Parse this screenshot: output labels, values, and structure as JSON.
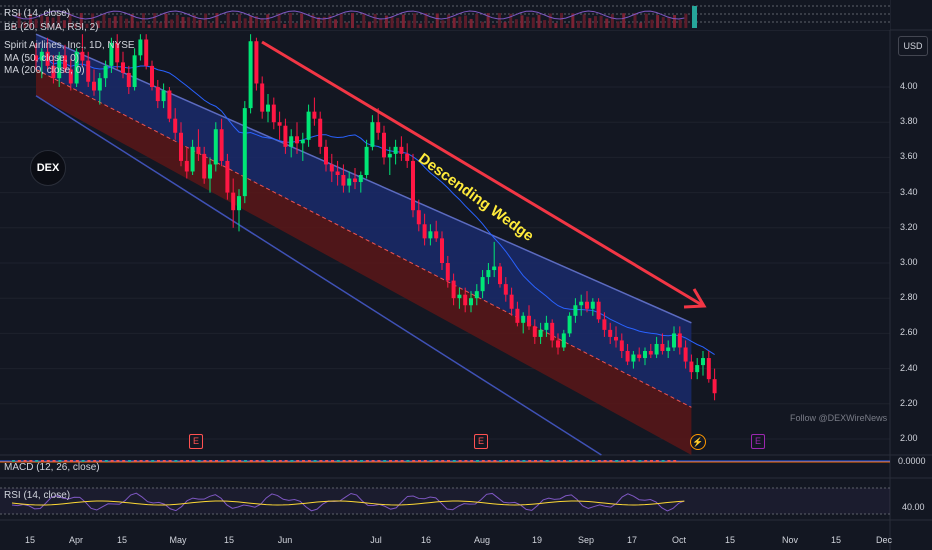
{
  "header": {
    "rsi_top": "RSI (14, close)",
    "bb_top": "BB (20, SMA, RSI, 2)",
    "symbol": "Spirit Airlines, Inc., 1D, NYSE",
    "ma50": "MA (50, close, 0)",
    "ma200": "MA (200, close, 0)"
  },
  "currency_button": "USD",
  "logo_text": "DEX",
  "annotation": "Descending Wedge",
  "watermark": "Follow @DEXWireNews",
  "macd_label": "MACD (12, 26, close)",
  "macd_value": "0.0000",
  "rsi_label": "RSI (14, close)",
  "rsi_value": "40.00",
  "earnings_badge": "E",
  "colors": {
    "up": "#00e676",
    "down": "#ff1744",
    "upper_fill": "#1a2a6b",
    "lower_fill": "#5a1618",
    "annotation": "#ffeb3b",
    "trend_arrow": "#f23645",
    "ma": "#2962ff"
  },
  "chart_data": {
    "type": "candlestick",
    "title": "Spirit Airlines, Inc., 1D, NYSE",
    "y_axis": {
      "ticks": [
        "4.00",
        "3.80",
        "3.60",
        "3.40",
        "3.20",
        "3.00",
        "2.80",
        "2.60",
        "2.40",
        "2.20",
        "2.00"
      ],
      "ylim": [
        1.9,
        4.35
      ]
    },
    "x_axis": {
      "ticks": [
        "15",
        "Apr",
        "15",
        "May",
        "15",
        "Jun",
        "Jul",
        "16",
        "Aug",
        "19",
        "Sep",
        "17",
        "Oct",
        "15",
        "Nov",
        "15",
        "Dec"
      ]
    },
    "candles": [
      {
        "o": 4.18,
        "h": 4.25,
        "l": 4.1,
        "c": 4.15
      },
      {
        "o": 4.15,
        "h": 4.22,
        "l": 4.05,
        "c": 4.2
      },
      {
        "o": 4.2,
        "h": 4.28,
        "l": 4.1,
        "c": 4.12
      },
      {
        "o": 4.12,
        "h": 4.18,
        "l": 4.02,
        "c": 4.05
      },
      {
        "o": 4.05,
        "h": 4.2,
        "l": 4.0,
        "c": 4.18
      },
      {
        "o": 4.18,
        "h": 4.24,
        "l": 4.08,
        "c": 4.1
      },
      {
        "o": 4.1,
        "h": 4.16,
        "l": 3.98,
        "c": 4.02
      },
      {
        "o": 4.02,
        "h": 4.22,
        "l": 4.0,
        "c": 4.2
      },
      {
        "o": 4.2,
        "h": 4.3,
        "l": 4.12,
        "c": 4.15
      },
      {
        "o": 4.15,
        "h": 4.2,
        "l": 4.0,
        "c": 4.03
      },
      {
        "o": 4.03,
        "h": 4.1,
        "l": 3.95,
        "c": 3.98
      },
      {
        "o": 3.98,
        "h": 4.08,
        "l": 3.9,
        "c": 4.05
      },
      {
        "o": 4.05,
        "h": 4.15,
        "l": 4.0,
        "c": 4.12
      },
      {
        "o": 4.12,
        "h": 4.28,
        "l": 4.08,
        "c": 4.25
      },
      {
        "o": 4.25,
        "h": 4.3,
        "l": 4.1,
        "c": 4.14
      },
      {
        "o": 4.14,
        "h": 4.2,
        "l": 4.05,
        "c": 4.08
      },
      {
        "o": 4.08,
        "h": 4.12,
        "l": 3.96,
        "c": 4.0
      },
      {
        "o": 4.0,
        "h": 4.22,
        "l": 3.98,
        "c": 4.18
      },
      {
        "o": 4.18,
        "h": 4.3,
        "l": 4.15,
        "c": 4.27
      },
      {
        "o": 4.27,
        "h": 4.3,
        "l": 4.1,
        "c": 4.12
      },
      {
        "o": 4.12,
        "h": 4.15,
        "l": 3.98,
        "c": 4.0
      },
      {
        "o": 4.0,
        "h": 4.04,
        "l": 3.88,
        "c": 3.92
      },
      {
        "o": 3.92,
        "h": 4.02,
        "l": 3.88,
        "c": 3.98
      },
      {
        "o": 3.98,
        "h": 4.0,
        "l": 3.8,
        "c": 3.82
      },
      {
        "o": 3.82,
        "h": 3.88,
        "l": 3.7,
        "c": 3.74
      },
      {
        "o": 3.74,
        "h": 3.8,
        "l": 3.55,
        "c": 3.58
      },
      {
        "o": 3.58,
        "h": 3.66,
        "l": 3.48,
        "c": 3.52
      },
      {
        "o": 3.52,
        "h": 3.7,
        "l": 3.5,
        "c": 3.66
      },
      {
        "o": 3.66,
        "h": 3.76,
        "l": 3.58,
        "c": 3.62
      },
      {
        "o": 3.62,
        "h": 3.66,
        "l": 3.45,
        "c": 3.48
      },
      {
        "o": 3.48,
        "h": 3.6,
        "l": 3.4,
        "c": 3.56
      },
      {
        "o": 3.56,
        "h": 3.8,
        "l": 3.52,
        "c": 3.76
      },
      {
        "o": 3.76,
        "h": 3.82,
        "l": 3.55,
        "c": 3.58
      },
      {
        "o": 3.58,
        "h": 3.62,
        "l": 3.36,
        "c": 3.4
      },
      {
        "o": 3.4,
        "h": 3.48,
        "l": 3.2,
        "c": 3.3
      },
      {
        "o": 3.3,
        "h": 3.42,
        "l": 3.18,
        "c": 3.38
      },
      {
        "o": 3.38,
        "h": 3.92,
        "l": 3.34,
        "c": 3.88
      },
      {
        "o": 3.88,
        "h": 4.3,
        "l": 3.85,
        "c": 4.26
      },
      {
        "o": 4.26,
        "h": 4.28,
        "l": 3.98,
        "c": 4.02
      },
      {
        "o": 4.02,
        "h": 4.06,
        "l": 3.82,
        "c": 3.86
      },
      {
        "o": 3.86,
        "h": 3.96,
        "l": 3.8,
        "c": 3.9
      },
      {
        "o": 3.9,
        "h": 3.94,
        "l": 3.76,
        "c": 3.8
      },
      {
        "o": 3.8,
        "h": 3.86,
        "l": 3.7,
        "c": 3.78
      },
      {
        "o": 3.78,
        "h": 3.82,
        "l": 3.62,
        "c": 3.66
      },
      {
        "o": 3.66,
        "h": 3.76,
        "l": 3.6,
        "c": 3.72
      },
      {
        "o": 3.72,
        "h": 3.8,
        "l": 3.62,
        "c": 3.68
      },
      {
        "o": 3.68,
        "h": 3.74,
        "l": 3.58,
        "c": 3.7
      },
      {
        "o": 3.7,
        "h": 3.9,
        "l": 3.66,
        "c": 3.86
      },
      {
        "o": 3.86,
        "h": 3.94,
        "l": 3.78,
        "c": 3.82
      },
      {
        "o": 3.82,
        "h": 3.86,
        "l": 3.62,
        "c": 3.66
      },
      {
        "o": 3.66,
        "h": 3.7,
        "l": 3.52,
        "c": 3.56
      },
      {
        "o": 3.56,
        "h": 3.62,
        "l": 3.46,
        "c": 3.52
      },
      {
        "o": 3.52,
        "h": 3.58,
        "l": 3.44,
        "c": 3.5
      },
      {
        "o": 3.5,
        "h": 3.56,
        "l": 3.4,
        "c": 3.44
      },
      {
        "o": 3.44,
        "h": 3.52,
        "l": 3.4,
        "c": 3.48
      },
      {
        "o": 3.48,
        "h": 3.54,
        "l": 3.42,
        "c": 3.46
      },
      {
        "o": 3.46,
        "h": 3.52,
        "l": 3.4,
        "c": 3.5
      },
      {
        "o": 3.5,
        "h": 3.7,
        "l": 3.48,
        "c": 3.66
      },
      {
        "o": 3.66,
        "h": 3.84,
        "l": 3.64,
        "c": 3.8
      },
      {
        "o": 3.8,
        "h": 3.88,
        "l": 3.7,
        "c": 3.74
      },
      {
        "o": 3.74,
        "h": 3.78,
        "l": 3.56,
        "c": 3.6
      },
      {
        "o": 3.6,
        "h": 3.66,
        "l": 3.5,
        "c": 3.62
      },
      {
        "o": 3.62,
        "h": 3.7,
        "l": 3.56,
        "c": 3.66
      },
      {
        "o": 3.66,
        "h": 3.72,
        "l": 3.58,
        "c": 3.62
      },
      {
        "o": 3.62,
        "h": 3.68,
        "l": 3.54,
        "c": 3.58
      },
      {
        "o": 3.58,
        "h": 3.62,
        "l": 3.26,
        "c": 3.3
      },
      {
        "o": 3.3,
        "h": 3.36,
        "l": 3.18,
        "c": 3.22
      },
      {
        "o": 3.22,
        "h": 3.28,
        "l": 3.1,
        "c": 3.14
      },
      {
        "o": 3.14,
        "h": 3.22,
        "l": 3.1,
        "c": 3.18
      },
      {
        "o": 3.18,
        "h": 3.24,
        "l": 3.12,
        "c": 3.14
      },
      {
        "o": 3.14,
        "h": 3.18,
        "l": 2.96,
        "c": 3.0
      },
      {
        "o": 3.0,
        "h": 3.04,
        "l": 2.86,
        "c": 2.9
      },
      {
        "o": 2.9,
        "h": 2.94,
        "l": 2.76,
        "c": 2.8
      },
      {
        "o": 2.8,
        "h": 2.86,
        "l": 2.74,
        "c": 2.82
      },
      {
        "o": 2.82,
        "h": 2.86,
        "l": 2.72,
        "c": 2.76
      },
      {
        "o": 2.76,
        "h": 2.84,
        "l": 2.72,
        "c": 2.8
      },
      {
        "o": 2.8,
        "h": 2.88,
        "l": 2.76,
        "c": 2.84
      },
      {
        "o": 2.84,
        "h": 2.96,
        "l": 2.8,
        "c": 2.92
      },
      {
        "o": 2.92,
        "h": 3.0,
        "l": 2.88,
        "c": 2.96
      },
      {
        "o": 2.96,
        "h": 3.12,
        "l": 2.92,
        "c": 2.98
      },
      {
        "o": 2.98,
        "h": 3.0,
        "l": 2.86,
        "c": 2.88
      },
      {
        "o": 2.88,
        "h": 2.92,
        "l": 2.78,
        "c": 2.82
      },
      {
        "o": 2.82,
        "h": 2.86,
        "l": 2.7,
        "c": 2.74
      },
      {
        "o": 2.74,
        "h": 2.78,
        "l": 2.64,
        "c": 2.66
      },
      {
        "o": 2.66,
        "h": 2.72,
        "l": 2.6,
        "c": 2.7
      },
      {
        "o": 2.7,
        "h": 2.76,
        "l": 2.62,
        "c": 2.64
      },
      {
        "o": 2.64,
        "h": 2.68,
        "l": 2.54,
        "c": 2.58
      },
      {
        "o": 2.58,
        "h": 2.66,
        "l": 2.54,
        "c": 2.62
      },
      {
        "o": 2.62,
        "h": 2.7,
        "l": 2.58,
        "c": 2.66
      },
      {
        "o": 2.66,
        "h": 2.68,
        "l": 2.52,
        "c": 2.56
      },
      {
        "o": 2.56,
        "h": 2.6,
        "l": 2.48,
        "c": 2.52
      },
      {
        "o": 2.52,
        "h": 2.62,
        "l": 2.5,
        "c": 2.6
      },
      {
        "o": 2.6,
        "h": 2.72,
        "l": 2.58,
        "c": 2.7
      },
      {
        "o": 2.7,
        "h": 2.8,
        "l": 2.66,
        "c": 2.76
      },
      {
        "o": 2.76,
        "h": 2.82,
        "l": 2.7,
        "c": 2.78
      },
      {
        "o": 2.78,
        "h": 2.84,
        "l": 2.72,
        "c": 2.74
      },
      {
        "o": 2.74,
        "h": 2.8,
        "l": 2.7,
        "c": 2.78
      },
      {
        "o": 2.78,
        "h": 2.8,
        "l": 2.66,
        "c": 2.68
      },
      {
        "o": 2.68,
        "h": 2.72,
        "l": 2.58,
        "c": 2.62
      },
      {
        "o": 2.62,
        "h": 2.66,
        "l": 2.54,
        "c": 2.58
      },
      {
        "o": 2.58,
        "h": 2.64,
        "l": 2.52,
        "c": 2.56
      },
      {
        "o": 2.56,
        "h": 2.6,
        "l": 2.46,
        "c": 2.5
      },
      {
        "o": 2.5,
        "h": 2.54,
        "l": 2.42,
        "c": 2.44
      },
      {
        "o": 2.44,
        "h": 2.5,
        "l": 2.4,
        "c": 2.48
      },
      {
        "o": 2.48,
        "h": 2.52,
        "l": 2.44,
        "c": 2.46
      },
      {
        "o": 2.46,
        "h": 2.52,
        "l": 2.42,
        "c": 2.5
      },
      {
        "o": 2.5,
        "h": 2.54,
        "l": 2.46,
        "c": 2.48
      },
      {
        "o": 2.48,
        "h": 2.58,
        "l": 2.46,
        "c": 2.54
      },
      {
        "o": 2.54,
        "h": 2.6,
        "l": 2.48,
        "c": 2.5
      },
      {
        "o": 2.5,
        "h": 2.56,
        "l": 2.46,
        "c": 2.52
      },
      {
        "o": 2.52,
        "h": 2.64,
        "l": 2.5,
        "c": 2.6
      },
      {
        "o": 2.6,
        "h": 2.64,
        "l": 2.48,
        "c": 2.52
      },
      {
        "o": 2.52,
        "h": 2.56,
        "l": 2.4,
        "c": 2.44
      },
      {
        "o": 2.44,
        "h": 2.48,
        "l": 2.34,
        "c": 2.38
      },
      {
        "o": 2.38,
        "h": 2.46,
        "l": 2.34,
        "c": 2.42
      },
      {
        "o": 2.42,
        "h": 2.5,
        "l": 2.36,
        "c": 2.46
      },
      {
        "o": 2.46,
        "h": 2.5,
        "l": 2.32,
        "c": 2.34
      },
      {
        "o": 2.34,
        "h": 2.4,
        "l": 2.22,
        "c": 2.26
      }
    ],
    "channel": {
      "upper": {
        "from": [
          0,
          4.3
        ],
        "to": [
          113,
          2.66
        ]
      },
      "mid": {
        "from": [
          0,
          4.1
        ],
        "to": [
          113,
          2.18
        ]
      },
      "lower": {
        "from": [
          0,
          3.95
        ],
        "to": [
          113,
          1.65
        ]
      }
    },
    "grid": true,
    "legend": "top-left"
  }
}
